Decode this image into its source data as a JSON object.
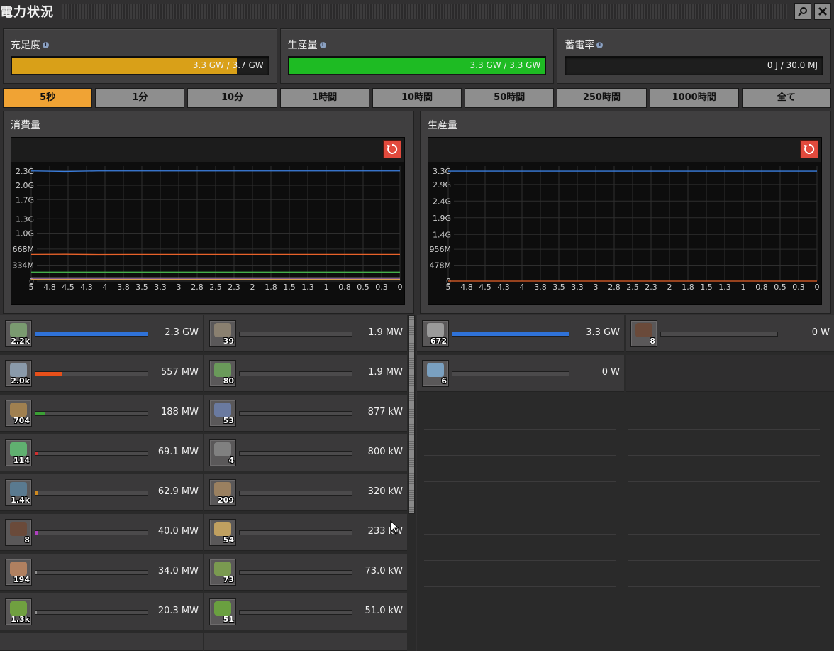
{
  "window": {
    "title": "電力状況"
  },
  "summary": {
    "satisfaction": {
      "label": "充足度",
      "value": "3.3 GW / 3.7 GW",
      "fill": 0.88,
      "color": "#d9a018"
    },
    "production": {
      "label": "生産量",
      "value": "3.3 GW / 3.3 GW",
      "fill": 1.0,
      "color": "#1ebb23"
    },
    "accumulator": {
      "label": "蓄電率",
      "value": "0 J / 30.0 MJ",
      "fill": 0,
      "color": "#1ebb23"
    }
  },
  "tabs": [
    {
      "label": "5秒",
      "active": true
    },
    {
      "label": "1分"
    },
    {
      "label": "10分"
    },
    {
      "label": "1時間"
    },
    {
      "label": "10時間"
    },
    {
      "label": "50時間"
    },
    {
      "label": "250時間"
    },
    {
      "label": "1000時間"
    },
    {
      "label": "全て"
    }
  ],
  "consumption": {
    "title": "消費量",
    "chart_data": {
      "type": "line",
      "yticks": [
        "2.3G",
        "2.0G",
        "1.7G",
        "1.3G",
        "1.0G",
        "668M",
        "334M",
        "0"
      ],
      "yvalues": [
        2300,
        2000,
        1700,
        1300,
        1000,
        668,
        334,
        0
      ],
      "ylim": [
        0,
        2400
      ],
      "xticks": [
        "5",
        "4.8",
        "4.5",
        "4.3",
        "4",
        "3.8",
        "3.5",
        "3.3",
        "3",
        "2.8",
        "2.5",
        "2.3",
        "2",
        "1.8",
        "1.5",
        "1.3",
        "1",
        "0.8",
        "0.5",
        "0.3",
        "0"
      ],
      "series": [
        {
          "color": "#3b7fe0",
          "values": [
            2300,
            2290,
            2300,
            2300,
            2300,
            2300,
            2300,
            2300,
            2300,
            2300,
            2300,
            2300
          ]
        },
        {
          "color": "#e8622a",
          "values": [
            557,
            560,
            555,
            557,
            557,
            557,
            557,
            557,
            557,
            557,
            557,
            557
          ]
        },
        {
          "color": "#45b04a",
          "values": [
            188,
            188,
            188,
            188,
            188,
            188,
            188,
            188,
            188,
            188,
            188,
            188
          ]
        },
        {
          "color": "#c8c8c8",
          "values": [
            69,
            69,
            69,
            69,
            69,
            69,
            69,
            69,
            69,
            69,
            69,
            69
          ]
        },
        {
          "color": "#9aa0a8",
          "values": [
            63,
            63,
            63,
            63,
            63,
            63,
            63,
            63,
            63,
            63,
            63,
            63
          ]
        },
        {
          "color": "#b040c0",
          "values": [
            40,
            40,
            40,
            40,
            40,
            40,
            40,
            40,
            40,
            40,
            40,
            40
          ]
        },
        {
          "color": "#d8a050",
          "values": [
            34,
            34,
            34,
            34,
            34,
            34,
            34,
            34,
            34,
            34,
            34,
            34
          ]
        }
      ]
    }
  },
  "production_graph": {
    "title": "生産量",
    "chart_data": {
      "type": "line",
      "yticks": [
        "3.3G",
        "2.9G",
        "2.4G",
        "1.9G",
        "1.4G",
        "956M",
        "478M",
        "0"
      ],
      "yvalues": [
        3300,
        2900,
        2400,
        1900,
        1400,
        956,
        478,
        0
      ],
      "ylim": [
        0,
        3450
      ],
      "xticks": [
        "5",
        "4.8",
        "4.5",
        "4.3",
        "4",
        "3.8",
        "3.5",
        "3.3",
        "3",
        "2.8",
        "2.5",
        "2.3",
        "2",
        "1.8",
        "1.5",
        "1.3",
        "1",
        "0.8",
        "0.5",
        "0.3",
        "0"
      ],
      "series": [
        {
          "color": "#3b7fe0",
          "values": [
            3300,
            3300,
            3300,
            3300,
            3300,
            3300,
            3300,
            3300,
            3300,
            3300,
            3300,
            3300
          ]
        },
        {
          "color": "#e8622a",
          "values": [
            0,
            0,
            0,
            0,
            0,
            0,
            0,
            0,
            0,
            0,
            0,
            0
          ]
        }
      ]
    }
  },
  "consumers_left": [
    {
      "icon": "assembler-icon",
      "count": "2.2k",
      "value": "2.3 GW",
      "fill": 1.0,
      "color": "#2f72d8",
      "gc": "#7a9a70"
    },
    {
      "icon": "refinery-icon",
      "count": "2.0k",
      "value": "557 MW",
      "fill": 0.24,
      "color": "#e8501a",
      "gc": "#8a9aaa"
    },
    {
      "icon": "miner-icon",
      "count": "704",
      "value": "188 MW",
      "fill": 0.08,
      "color": "#3ba035",
      "gc": "#a08050"
    },
    {
      "icon": "module-icon",
      "count": "114",
      "value": "69.1 MW",
      "fill": 0.02,
      "color": "#d03030",
      "gc": "#60b070"
    },
    {
      "icon": "lab-icon",
      "count": "1.4k",
      "value": "62.9 MW",
      "fill": 0.02,
      "color": "#d08a20",
      "gc": "#5a7a90"
    },
    {
      "icon": "turret-icon",
      "count": "8",
      "value": "40.0 MW",
      "fill": 0.02,
      "color": "#b040c0",
      "gc": "#6a4a3a"
    },
    {
      "icon": "furnace-icon",
      "count": "194",
      "value": "34.0 MW",
      "fill": 0.01,
      "color": "#909090",
      "gc": "#b08060"
    },
    {
      "icon": "inserter-icon",
      "count": "1.3k",
      "value": "20.3 MW",
      "fill": 0.01,
      "color": "#909090",
      "gc": "#70a040"
    }
  ],
  "consumers_right": [
    {
      "icon": "radar-icon",
      "count": "39",
      "value": "1.9 MW",
      "fill": 0,
      "color": "#909090",
      "gc": "#8a8070"
    },
    {
      "icon": "pump-icon",
      "count": "80",
      "value": "1.9 MW",
      "fill": 0,
      "color": "#909090",
      "gc": "#6a9a5a"
    },
    {
      "icon": "gear-machine-icon",
      "count": "53",
      "value": "877 kW",
      "fill": 0,
      "color": "#909090",
      "gc": "#6a7aa0"
    },
    {
      "icon": "roboport-icon",
      "count": "4",
      "value": "800 kW",
      "fill": 0,
      "color": "#909090",
      "gc": "#808080"
    },
    {
      "icon": "drill-icon",
      "count": "209",
      "value": "320 kW",
      "fill": 0,
      "color": "#909090",
      "gc": "#9a8060"
    },
    {
      "icon": "beacon-icon",
      "count": "54",
      "value": "233 kW",
      "fill": 0,
      "color": "#909090",
      "gc": "#c0a060"
    },
    {
      "icon": "medkit-icon",
      "count": "73",
      "value": "73.0 kW",
      "fill": 0,
      "color": "#909090",
      "gc": "#7a9a50"
    },
    {
      "icon": "console-icon",
      "count": "51",
      "value": "51.0 kW",
      "fill": 0,
      "color": "#909090",
      "gc": "#6aa040"
    }
  ],
  "producers_left": [
    {
      "icon": "steam-turbine-icon",
      "count": "672",
      "value": "3.3 GW",
      "fill": 1.0,
      "color": "#2f72d8",
      "gc": "#9a9a9a"
    },
    {
      "icon": "solar-icon",
      "count": "6",
      "value": "0 W",
      "fill": 0,
      "color": "#909090",
      "gc": "#7aa0c0"
    }
  ],
  "producers_right": [
    {
      "icon": "generator-icon",
      "count": "8",
      "value": "0 W",
      "fill": 0,
      "color": "#909090",
      "gc": "#6a4a3a"
    }
  ]
}
